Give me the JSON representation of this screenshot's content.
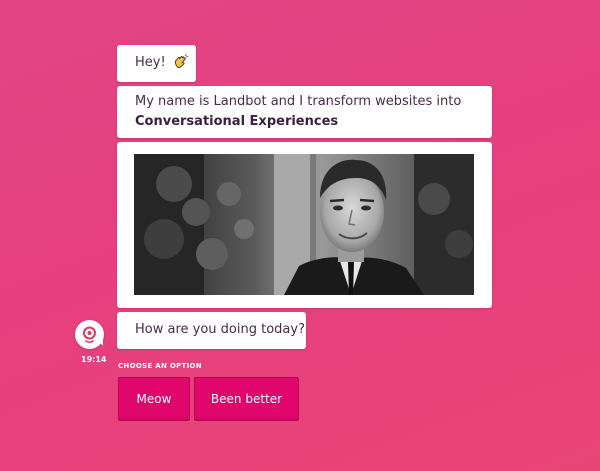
{
  "chat": {
    "greeting": "Hey!",
    "intro_line1": "My name is Landbot and I transform websites into",
    "intro_line2": "Conversational Experiences",
    "question": "How are you doing today?",
    "timestamp": "19:14",
    "choose_label": "CHOOSE AN OPTION",
    "options": [
      {
        "label": "Meow"
      },
      {
        "label": "Been better"
      }
    ]
  },
  "icons": {
    "greeting_emoji": "waving-hand-icon",
    "avatar": "landbot-logo-icon"
  },
  "colors": {
    "background": "#e63f7e",
    "option_button": "#e0066b",
    "text": "#4a2a4a"
  }
}
